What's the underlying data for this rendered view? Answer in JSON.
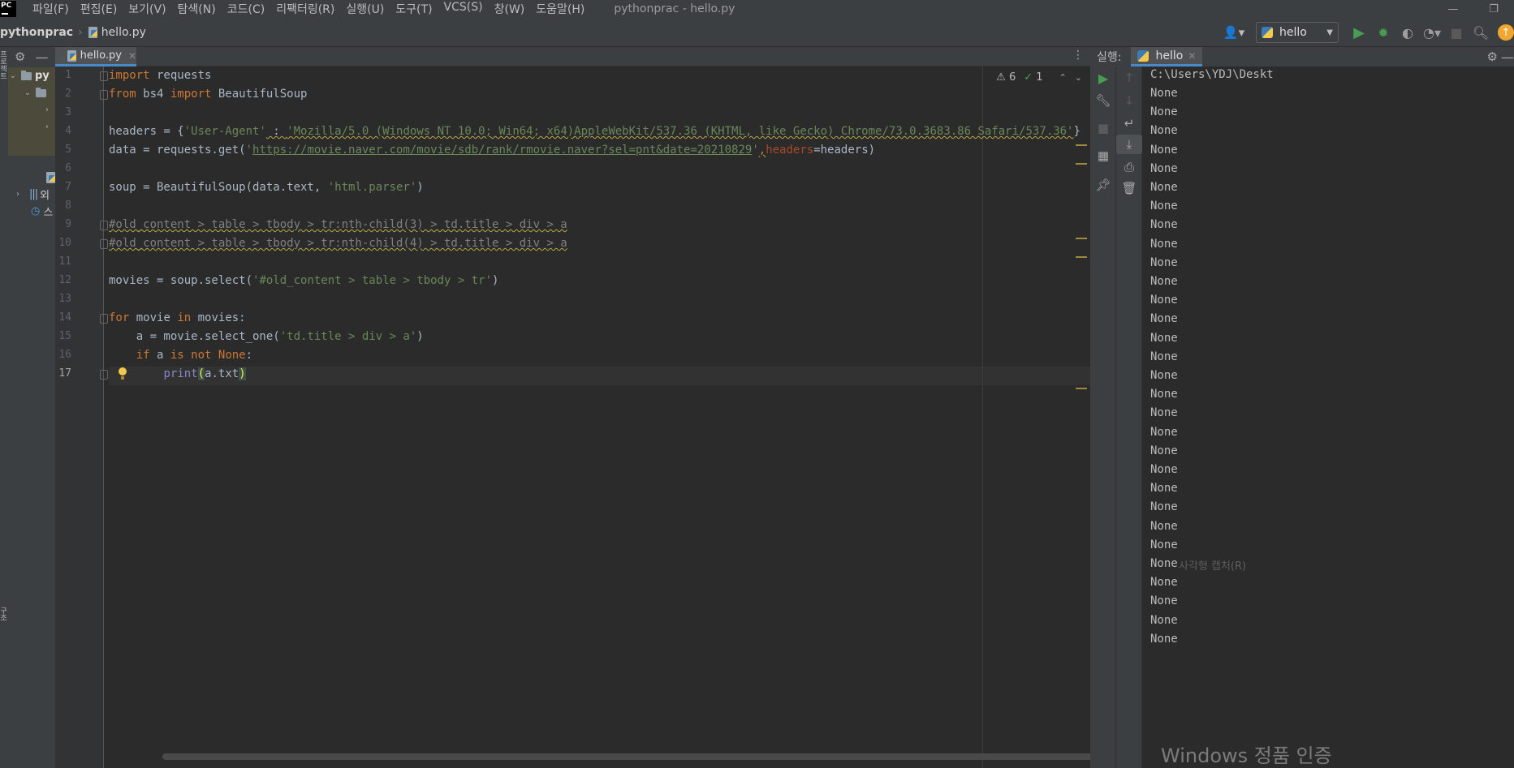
{
  "menubar": {
    "logo": "PC",
    "items": [
      "파일(F)",
      "편집(E)",
      "보기(V)",
      "탐색(N)",
      "코드(C)",
      "리팩터링(R)",
      "실행(U)",
      "도구(T)",
      "VCS(S)",
      "창(W)",
      "도움말(H)"
    ],
    "window_title": "pythonprac - hello.py",
    "minimize": "—",
    "restore": "❐"
  },
  "navbar": {
    "project": "pythonprac",
    "file": "hello.py",
    "run_config": "hello",
    "icons": [
      "user-icon",
      "run-icon",
      "debug-icon",
      "coverage-icon",
      "profile-icon",
      "stop-icon",
      "search-icon",
      "update-icon"
    ]
  },
  "project_panel": {
    "root_label": "py",
    "libs_label": "외",
    "scratch_label": "스"
  },
  "left_strip": {
    "top_label": "프로젝트",
    "bottom_label": "구조"
  },
  "editor": {
    "tab_label": "hello.py",
    "warnings": "6",
    "ok_count": "1",
    "line_numbers": [
      "1",
      "2",
      "3",
      "4",
      "5",
      "6",
      "7",
      "8",
      "9",
      "10",
      "11",
      "12",
      "13",
      "14",
      "15",
      "16",
      "17"
    ],
    "code": {
      "l1": {
        "kw": "import",
        "rest": " requests"
      },
      "l2": {
        "kw1": "from",
        "mid": " bs4 ",
        "kw2": "import",
        "rest": " BeautifulSoup"
      },
      "l4": {
        "pre": "headers = {",
        "key": "'User-Agent'",
        "sep": " : ",
        "val": "'Mozilla/5.0 (Windows NT 10.0; Win64; x64)AppleWebKit/537.36 (KHTML, like Gecko) Chrome/73.0.3683.86 Safari/537.36'",
        "post": "}"
      },
      "l5": {
        "pre": "data = requests.get(",
        "q1": "'",
        "url": "https://movie.naver.com/movie/sdb/rank/rmovie.naver?sel=pnt&date=20210829",
        "q2": "'",
        "comma": ",",
        "param": "headers",
        "post": "=headers)"
      },
      "l7": {
        "pre": "soup = BeautifulSoup(data.text, ",
        "str": "'html.parser'",
        "post": ")"
      },
      "l9": "#old_content > table > tbody > tr:nth-child(3) > td.title > div > a",
      "l10": "#old_content > table > tbody > tr:nth-child(4) > td.title > div > a",
      "l12": {
        "pre": "movies = soup.select(",
        "str": "'#old_content > table > tbody > tr'",
        "post": ")"
      },
      "l14": {
        "kw1": "for",
        "mid": " movie ",
        "kw2": "in",
        "rest": " movies:"
      },
      "l15": {
        "pre": "    a = movie.select_one(",
        "str": "'td.title > div > a'",
        "post": ")"
      },
      "l16": {
        "indent": "    ",
        "kw1": "if",
        "mid": " a ",
        "kw2": "is not",
        "sp": " ",
        "kw3": "None",
        "post": ":"
      },
      "l17": {
        "indent": "        ",
        "fn": "print",
        "open": "(",
        "mid": "a.txt",
        "close": ")"
      }
    }
  },
  "run_panel": {
    "title": "실행:",
    "tab": "hello",
    "path_line": "C:\\Users\\YDJ\\Deskt",
    "output": [
      "None",
      "None",
      "None",
      "None",
      "None",
      "None",
      "None",
      "None",
      "None",
      "None",
      "None",
      "None",
      "None",
      "None",
      "None",
      "None",
      "None",
      "None",
      "None",
      "None",
      "None",
      "None",
      "None",
      "None",
      "None",
      "None",
      "None",
      "None",
      "None",
      "None"
    ],
    "ime_hint": "사각형 캡처(R)"
  },
  "watermark": "Windows 정품 인증"
}
